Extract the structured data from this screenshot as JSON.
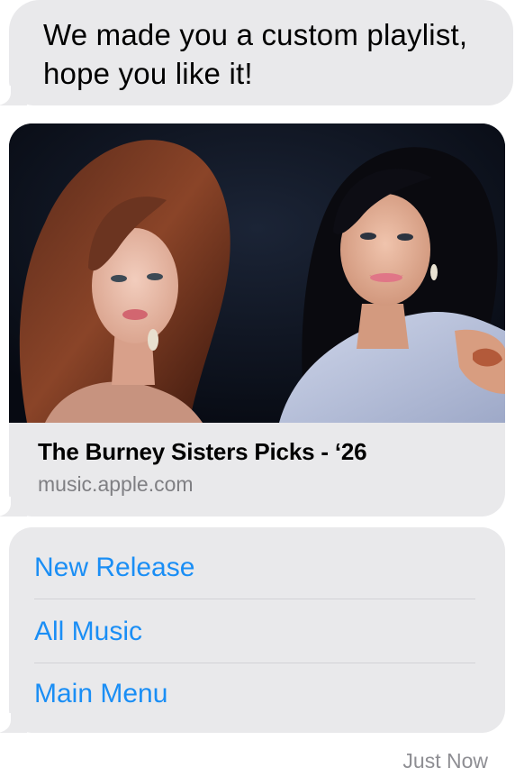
{
  "messages": {
    "text": "We made you a custom playlist, hope you like it!",
    "link_card": {
      "title": "The Burney Sisters Picks - ‘26",
      "domain": "music.apple.com"
    },
    "menu": {
      "items": [
        {
          "label": "New Release"
        },
        {
          "label": "All Music"
        },
        {
          "label": "Main Menu"
        }
      ]
    },
    "timestamp": "Just Now"
  },
  "colors": {
    "bubble": "#e9e9eb",
    "link": "#1a8ef5",
    "secondary_text": "#7f7f83"
  }
}
